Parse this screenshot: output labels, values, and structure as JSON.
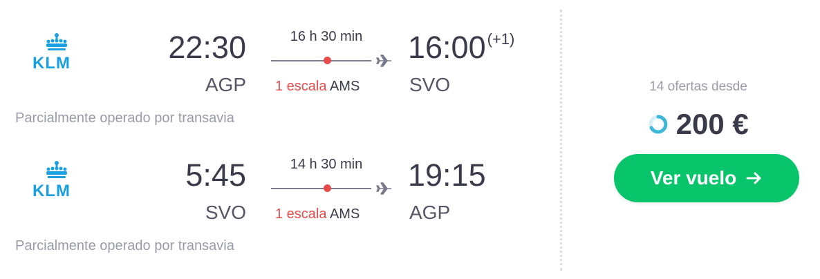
{
  "legs": [
    {
      "airline": "KLM",
      "departure_time": "22:30",
      "departure_code": "AGP",
      "duration": "16 h 30 min",
      "stops": "1 escala",
      "via": "AMS",
      "arrival_time": "16:00",
      "arrival_day_offset": "(+1)",
      "arrival_code": "SVO",
      "note": "Parcialmente operado por transavia"
    },
    {
      "airline": "KLM",
      "departure_time": "5:45",
      "departure_code": "SVO",
      "duration": "14 h 30 min",
      "stops": "1 escala",
      "via": "AMS",
      "arrival_time": "19:15",
      "arrival_day_offset": "",
      "arrival_code": "AGP",
      "note": "Parcialmente operado por transavia"
    }
  ],
  "pricing": {
    "offers_text": "14 ofertas desde",
    "price": "200 €",
    "cta_label": "Ver vuelo"
  },
  "icons": {
    "airline_logo": "klm-crown-icon",
    "plane": "plane-icon",
    "loading": "spinner-icon",
    "cta_arrow": "arrow-right-icon"
  },
  "colors": {
    "accent_green": "#08c46b",
    "stop_red": "#e84b4b",
    "klm_blue": "#1aa0e0",
    "muted": "#9a9aa8"
  }
}
